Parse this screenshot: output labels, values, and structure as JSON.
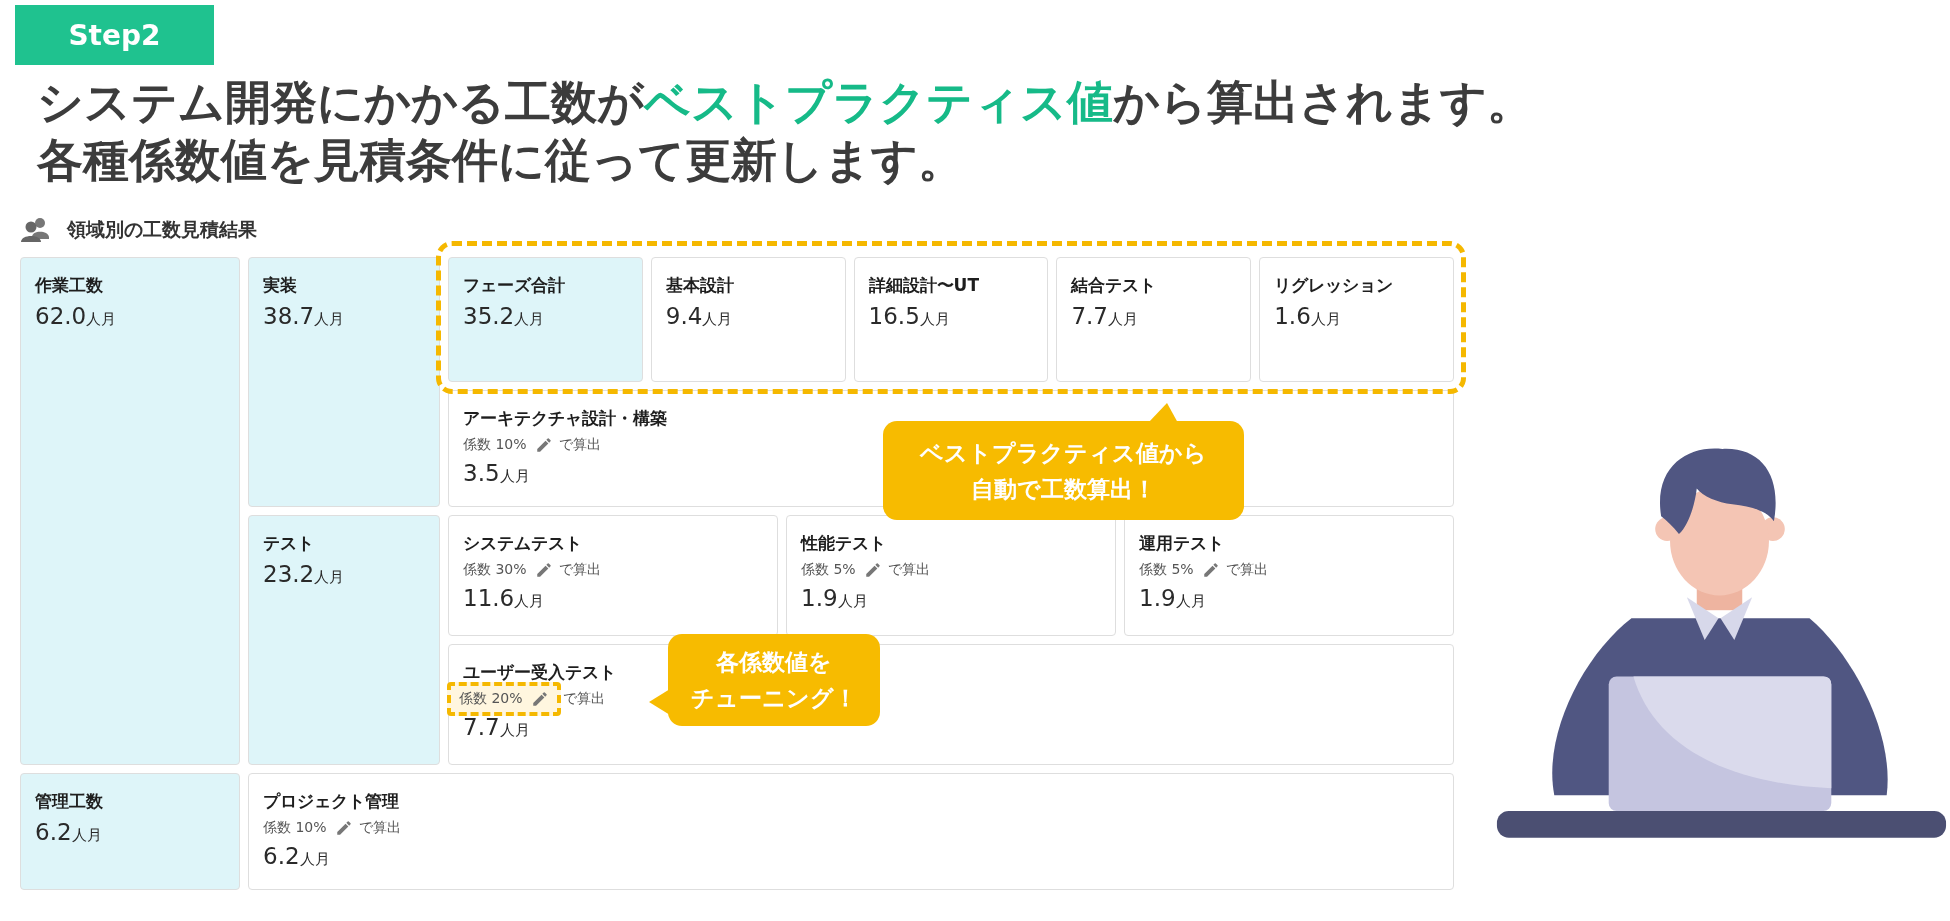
{
  "step_badge": "Step2",
  "headline": [
    "システム開発にかかる工数が**ベストプラクティス値**から算出されます。",
    "各種係数値を見積条件に従って更新します。"
  ],
  "section": {
    "title": "領域別の工数見積結果"
  },
  "total": {
    "label": "作業工数",
    "value": "62.0",
    "unit": "人月"
  },
  "groups": [
    {
      "label": "実装",
      "value": "38.7",
      "unit": "人月",
      "phases": [
        {
          "kind": "total",
          "label": "フェーズ合計",
          "value": "35.2",
          "unit": "人月"
        },
        {
          "kind": "phase",
          "label": "基本設計",
          "value": "9.4",
          "unit": "人月"
        },
        {
          "kind": "phase",
          "label": "詳細設計〜UT",
          "value": "16.5",
          "unit": "人月"
        },
        {
          "kind": "phase",
          "label": "結合テスト",
          "value": "7.7",
          "unit": "人月"
        },
        {
          "kind": "phase",
          "label": "リグレッション",
          "value": "1.6",
          "unit": "人月"
        }
      ],
      "items": [
        {
          "label": "アーキテクチャ設計・構築",
          "coef": "係数 10%",
          "calc": "で算出",
          "value": "3.5",
          "unit": "人月",
          "highlighted": false
        }
      ]
    },
    {
      "label": "テスト",
      "value": "23.2",
      "unit": "人月",
      "items": [
        {
          "label": "システムテスト",
          "coef": "係数 30%",
          "calc": "で算出",
          "value": "11.6",
          "unit": "人月",
          "highlighted": false
        },
        {
          "label": "性能テスト",
          "coef": "係数 5%",
          "calc": "で算出",
          "value": "1.9",
          "unit": "人月",
          "highlighted": false
        },
        {
          "label": "運用テスト",
          "coef": "係数 5%",
          "calc": "で算出",
          "value": "1.9",
          "unit": "人月",
          "highlighted": false
        },
        {
          "label": "ユーザー受入テスト",
          "coef": "係数 20%",
          "calc": "で算出",
          "value": "7.7",
          "unit": "人月",
          "highlighted": true
        }
      ]
    }
  ],
  "management": {
    "label": "管理工数",
    "value": "6.2",
    "unit": "人月",
    "items": [
      {
        "label": "プロジェクト管理",
        "coef": "係数 10%",
        "calc": "で算出",
        "value": "6.2",
        "unit": "人月",
        "highlighted": false
      }
    ]
  },
  "callouts": [
    {
      "lines": [
        "ベストプラクティス値から",
        "自動で工数算出！"
      ]
    },
    {
      "lines": [
        "各係数値を",
        "チューニング！"
      ]
    }
  ]
}
